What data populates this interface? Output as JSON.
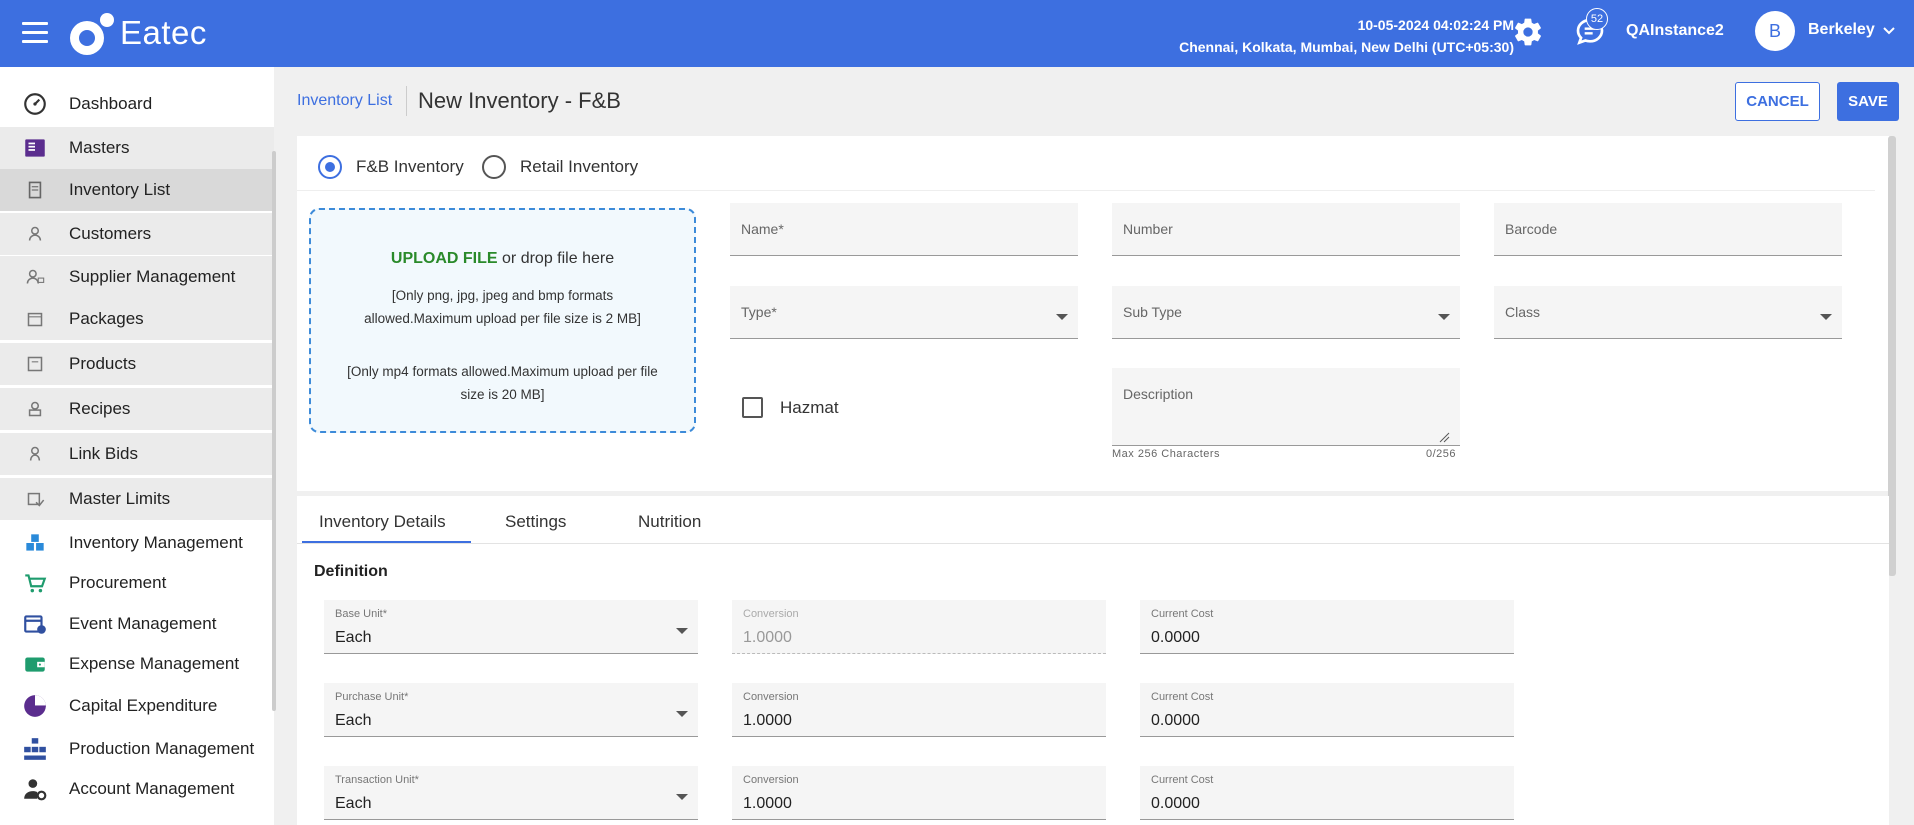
{
  "app": {
    "name": "Eatec"
  },
  "header": {
    "datetime": "10-05-2024 04:02:24 PM",
    "timezone": "Chennai, Kolkata, Mumbai, New Delhi (UTC+05:30)",
    "notification_count": "52",
    "instance": "QAInstance2",
    "avatar_initial": "B",
    "user": "Berkeley"
  },
  "sidebar": {
    "items": [
      {
        "label": "Dashboard",
        "icon": "dashboard-gauge-icon"
      },
      {
        "label": "Masters",
        "icon": "masters-book-icon"
      },
      {
        "label": "Inventory List",
        "icon": "inventory-list-icon"
      },
      {
        "label": "Customers",
        "icon": "customers-icon"
      },
      {
        "label": "Supplier Management",
        "icon": "supplier-icon"
      },
      {
        "label": "Packages",
        "icon": "packages-icon"
      },
      {
        "label": "Products",
        "icon": "products-icon"
      },
      {
        "label": "Recipes",
        "icon": "recipes-icon"
      },
      {
        "label": "Link Bids",
        "icon": "link-bids-icon"
      },
      {
        "label": "Master Limits",
        "icon": "master-limits-icon"
      },
      {
        "label": "Inventory Management",
        "icon": "inventory-management-icon"
      },
      {
        "label": "Procurement",
        "icon": "procurement-cart-icon"
      },
      {
        "label": "Event Management",
        "icon": "event-calendar-icon"
      },
      {
        "label": "Expense Management",
        "icon": "wallet-icon"
      },
      {
        "label": "Capital Expenditure",
        "icon": "pie-chart-icon"
      },
      {
        "label": "Production Management",
        "icon": "production-icon"
      },
      {
        "label": "Account Management",
        "icon": "account-gear-icon"
      }
    ]
  },
  "page": {
    "breadcrumb": "Inventory List",
    "title": "New Inventory - F&B",
    "cancel": "CANCEL",
    "save": "SAVE"
  },
  "form": {
    "radio_fb": "F&B Inventory",
    "radio_retail": "Retail Inventory",
    "upload_link": "UPLOAD FILE",
    "upload_rest": " or drop file here",
    "upload_note_image": "[Only png, jpg, jpeg and bmp formats allowed.Maximum upload per file size is 2 MB]",
    "upload_note_video": "[Only mp4 formats allowed.Maximum upload per file size is 20 MB]",
    "name_label": "Name*",
    "number_label": "Number",
    "barcode_label": "Barcode",
    "type_label": "Type*",
    "subtype_label": "Sub Type",
    "class_label": "Class",
    "hazmat_label": "Hazmat",
    "description_label": "Description",
    "description_hint": "Max 256 Characters",
    "description_count": "0/256"
  },
  "tabs": {
    "details": "Inventory Details",
    "settings": "Settings",
    "nutrition": "Nutrition"
  },
  "definition": {
    "title": "Definition",
    "rows": [
      {
        "unit_label": "Base Unit*",
        "unit_value": "Each",
        "conv_label": "Conversion",
        "conv_value": "1.0000",
        "cost_label": "Current Cost",
        "cost_value": "0.0000"
      },
      {
        "unit_label": "Purchase Unit*",
        "unit_value": "Each",
        "conv_label": "Conversion",
        "conv_value": "1.0000",
        "cost_label": "Current Cost",
        "cost_value": "0.0000"
      },
      {
        "unit_label": "Transaction Unit*",
        "unit_value": "Each",
        "conv_label": "Conversion",
        "conv_value": "1.0000",
        "cost_label": "Current Cost",
        "cost_value": "0.0000"
      }
    ]
  },
  "colors": {
    "primary": "#3d6fe0",
    "upload_link": "#2a8a2a"
  }
}
